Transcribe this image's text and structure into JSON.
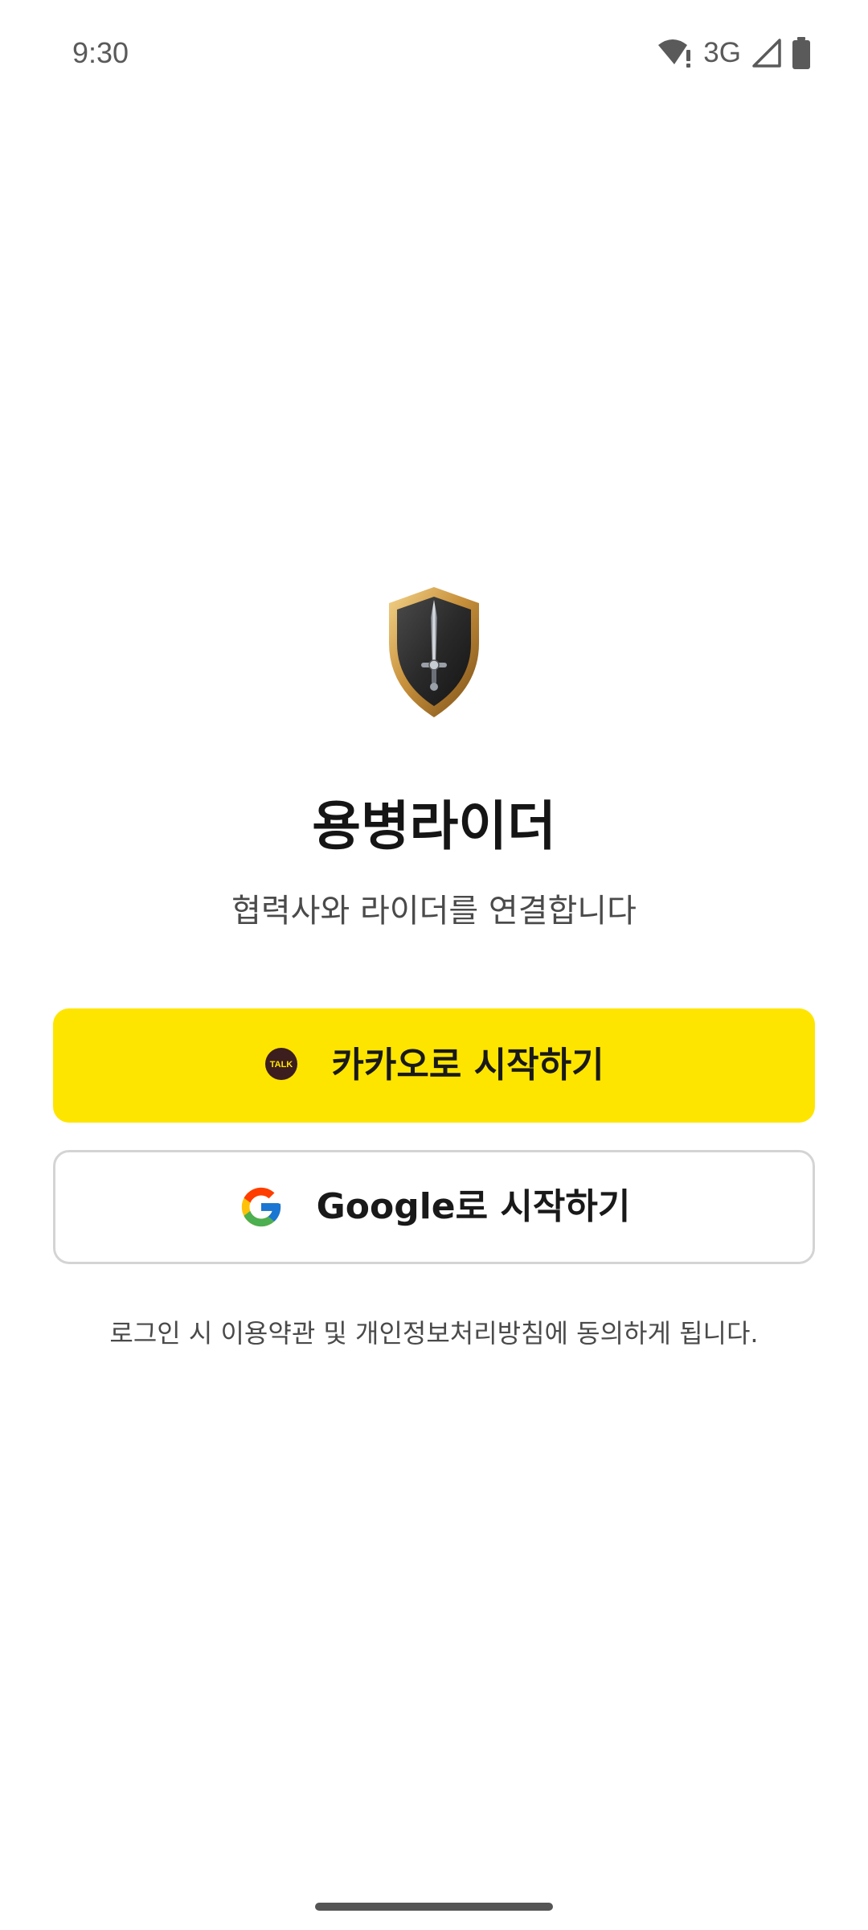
{
  "status_bar": {
    "time": "9:30",
    "network": "3G",
    "icons": [
      "wifi-alert-icon",
      "signal-icon",
      "battery-icon"
    ]
  },
  "logo": {
    "icon": "shield-sword-icon"
  },
  "app": {
    "title": "용병라이더",
    "subtitle": "협력사와 라이더를 연결합니다"
  },
  "buttons": {
    "kakao_label": "카카오로 시작하기",
    "kakao_icon_text": "TALK",
    "google_label": "Google로 시작하기"
  },
  "terms": {
    "text": "로그인 시 이용약관 및 개인정보처리방침에 동의하게 됩니다."
  },
  "colors": {
    "kakao_yellow": "#FEE500",
    "kakao_brown": "#3C1E1E",
    "text_dark": "#151515",
    "text_muted": "#4a4a4a",
    "border": "#d4d4d4"
  }
}
